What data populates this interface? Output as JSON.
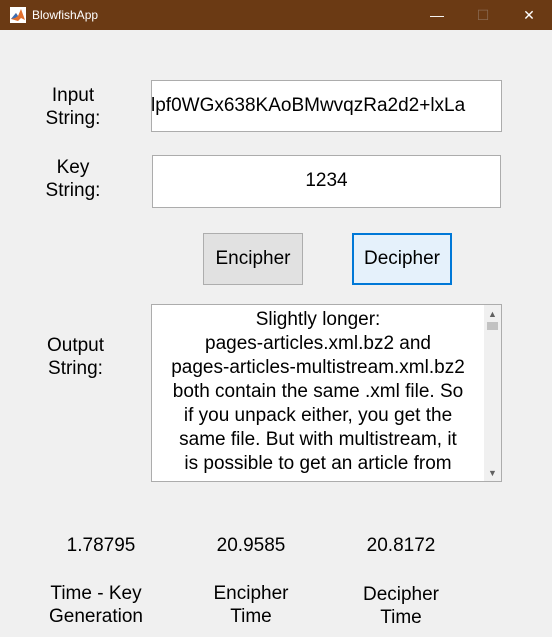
{
  "window": {
    "title": "BlowfishApp",
    "controls": {
      "minimize": "—",
      "maximize": "☐",
      "close": "✕"
    }
  },
  "form": {
    "input_label": "Input\nString:",
    "input_value": "lpf0WGx638KAoBMwvqzRa2d2+lxLa",
    "key_label": "Key\nString:",
    "key_value": "1234",
    "encipher_label": "Encipher",
    "decipher_label": "Decipher",
    "output_label": "Output\nString:",
    "output_text": "Slightly longer:\npages-articles.xml.bz2 and\npages-articles-multistream.xml.bz2\nboth contain the same .xml file. So\nif you unpack either, you get the\nsame file. But with multistream, it\nis possible to get an article from"
  },
  "timings": {
    "key_generation_value": "1.78795",
    "encipher_value": "20.9585",
    "decipher_value": "20.8172",
    "key_generation_label": "Time - Key\nGeneration",
    "encipher_label": "Encipher\nTime",
    "decipher_label": "Decipher\nTime"
  },
  "colors": {
    "titlebar": "#6b3a14",
    "window_bg": "#f0f0f0",
    "focus_border": "#0078d7"
  },
  "icons": {
    "app": "matlab-icon",
    "scroll_up": "chevron-up-icon",
    "scroll_down": "chevron-down-icon"
  }
}
